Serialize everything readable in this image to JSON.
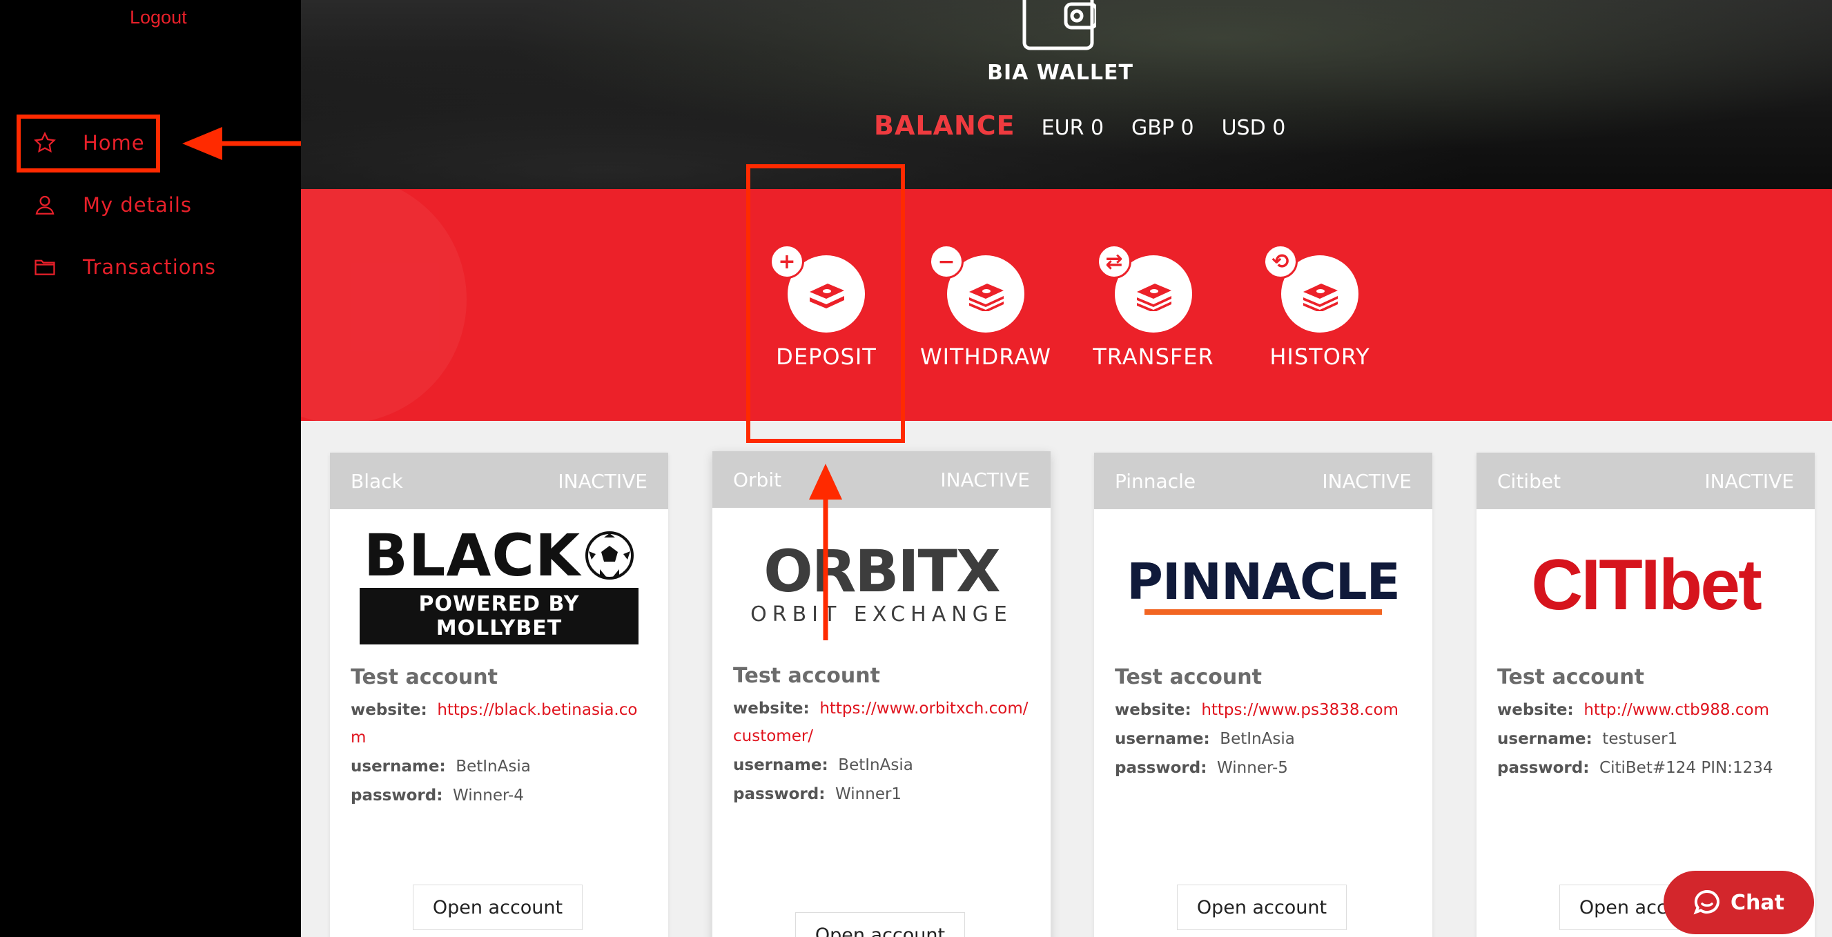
{
  "sidebar": {
    "logout": "Logout",
    "items": [
      {
        "label": "Home",
        "icon": "star-icon"
      },
      {
        "label": "My details",
        "icon": "user-icon"
      },
      {
        "label": "Transactions",
        "icon": "folder-icon"
      }
    ]
  },
  "header": {
    "wallet_title": "BIA WALLET",
    "balance_label": "BALANCE",
    "balances": [
      "EUR 0",
      "GBP 0",
      "USD 0"
    ]
  },
  "actions": [
    {
      "label": "DEPOSIT",
      "badge": "+"
    },
    {
      "label": "WITHDRAW",
      "badge": "−"
    },
    {
      "label": "TRANSFER",
      "badge": "⇄"
    },
    {
      "label": "HISTORY",
      "badge": "⟲"
    }
  ],
  "cards": [
    {
      "name": "Black",
      "status": "INACTIVE",
      "logo_text": "BLACK",
      "logo_sub": "POWERED BY MOLLYBET",
      "title": "Test account",
      "website_label": "website:",
      "website": "https://black.betinasia.com",
      "username_label": "username:",
      "username": "BetInAsia",
      "password_label": "password:",
      "password": "Winner-4",
      "button": "Open account"
    },
    {
      "name": "Orbit",
      "status": "INACTIVE",
      "logo_text": "ORBITX",
      "logo_sub": "ORBIT EXCHANGE",
      "title": "Test account",
      "website_label": "website:",
      "website": "https://www.orbitxch.com/customer/",
      "username_label": "username:",
      "username": "BetInAsia",
      "password_label": "password:",
      "password": "Winner1",
      "button": "Open account"
    },
    {
      "name": "Pinnacle",
      "status": "INACTIVE",
      "logo_text": "PINNACLE",
      "title": "Test account",
      "website_label": "website:",
      "website": "https://www.ps3838.com",
      "username_label": "username:",
      "username": "BetInAsia",
      "password_label": "password:",
      "password": "Winner-5",
      "button": "Open account"
    },
    {
      "name": "Citibet",
      "status": "INACTIVE",
      "logo_text": "CITIbet",
      "title": "Test account",
      "website_label": "website:",
      "website": "http://www.ctb988.com",
      "username_label": "username:",
      "username": "testuser1",
      "password_label": "password:",
      "password": "CitiBet#124 PIN:1234",
      "button": "Open account"
    }
  ],
  "chat": {
    "label": "Chat"
  },
  "colors": {
    "accent": "#ec2129",
    "annotation": "#ff2a00",
    "sidebar": "#000000"
  }
}
